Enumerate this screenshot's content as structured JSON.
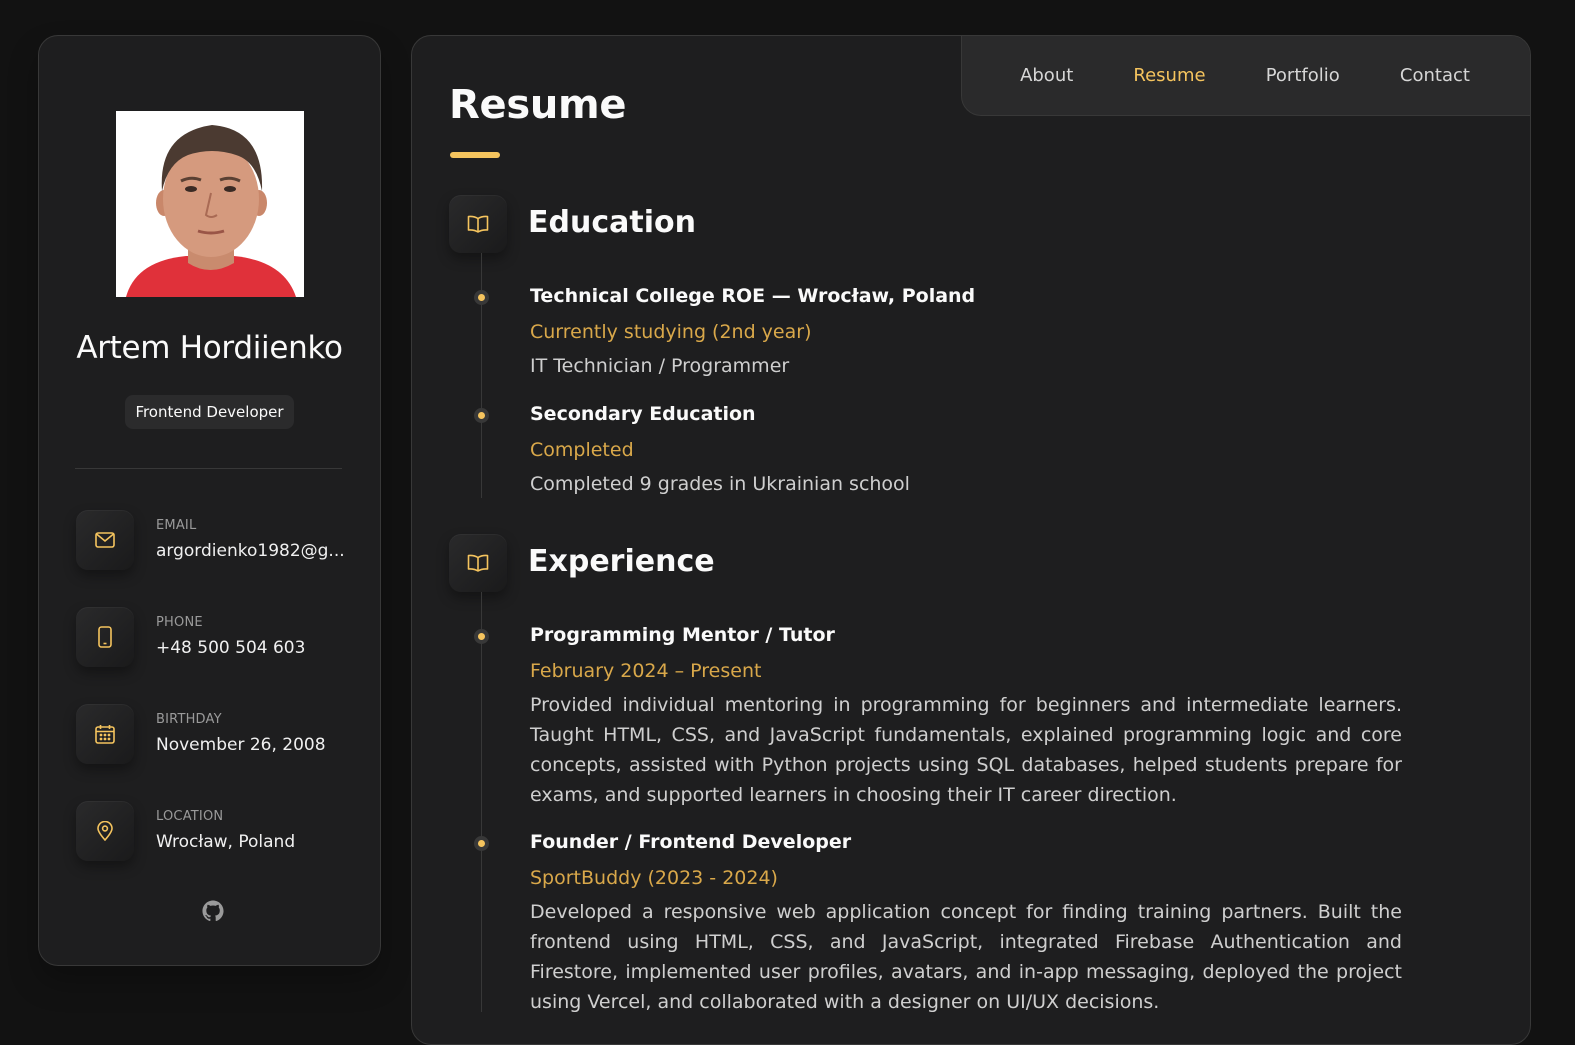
{
  "profile": {
    "name": "Artem Hordiienko",
    "role": "Frontend Developer",
    "contacts": [
      {
        "label": "Email",
        "value": "argordienko1982@g...",
        "icon": "mail-icon"
      },
      {
        "label": "Phone",
        "value": "+48 500 504 603",
        "icon": "phone-icon"
      },
      {
        "label": "Birthday",
        "value": "November 26, 2008",
        "icon": "calendar-icon"
      },
      {
        "label": "Location",
        "value": "Wrocław, Poland",
        "icon": "map-pin-icon"
      }
    ],
    "social": [
      "github-icon"
    ]
  },
  "nav": {
    "items": [
      {
        "label": "About",
        "active": false
      },
      {
        "label": "Resume",
        "active": true
      },
      {
        "label": "Portfolio",
        "active": false
      },
      {
        "label": "Contact",
        "active": false
      }
    ]
  },
  "page": {
    "title": "Resume"
  },
  "sections": [
    {
      "title": "Education",
      "icon": "book-open-icon",
      "items": [
        {
          "heading": "Technical College ROE — Wrocław, Poland",
          "sub": "Currently studying (2nd year)",
          "text": "IT Technician / Programmer"
        },
        {
          "heading": "Secondary Education",
          "sub": "Completed",
          "text": "Completed 9 grades in Ukrainian school"
        }
      ]
    },
    {
      "title": "Experience",
      "icon": "book-open-icon",
      "items": [
        {
          "heading": "Programming Mentor / Tutor",
          "sub": "February 2024 – Present",
          "text": "Provided individual mentoring in programming for beginners and intermediate learners. Taught HTML, CSS, and JavaScript fundamentals, explained programming logic and core concepts, assisted with Python projects using SQL databases, helped students prepare for exams, and supported learners in choosing their IT career direction."
        },
        {
          "heading": "Founder / Frontend Developer",
          "sub": "SportBuddy (2023 - 2024)",
          "text": "Developed a responsive web application concept for finding training partners. Built the frontend using HTML, CSS, and JavaScript, integrated Firebase Authentication and Firestore, implemented user profiles, avatars, and in-app messaging, deployed the project using Vercel, and collaborated with a designer on UI/UX decisions."
        }
      ]
    }
  ],
  "colors": {
    "accent": "#f5c45e",
    "accent_text": "#d9a84a",
    "background": "#121212",
    "card": "#1e1e1f"
  }
}
